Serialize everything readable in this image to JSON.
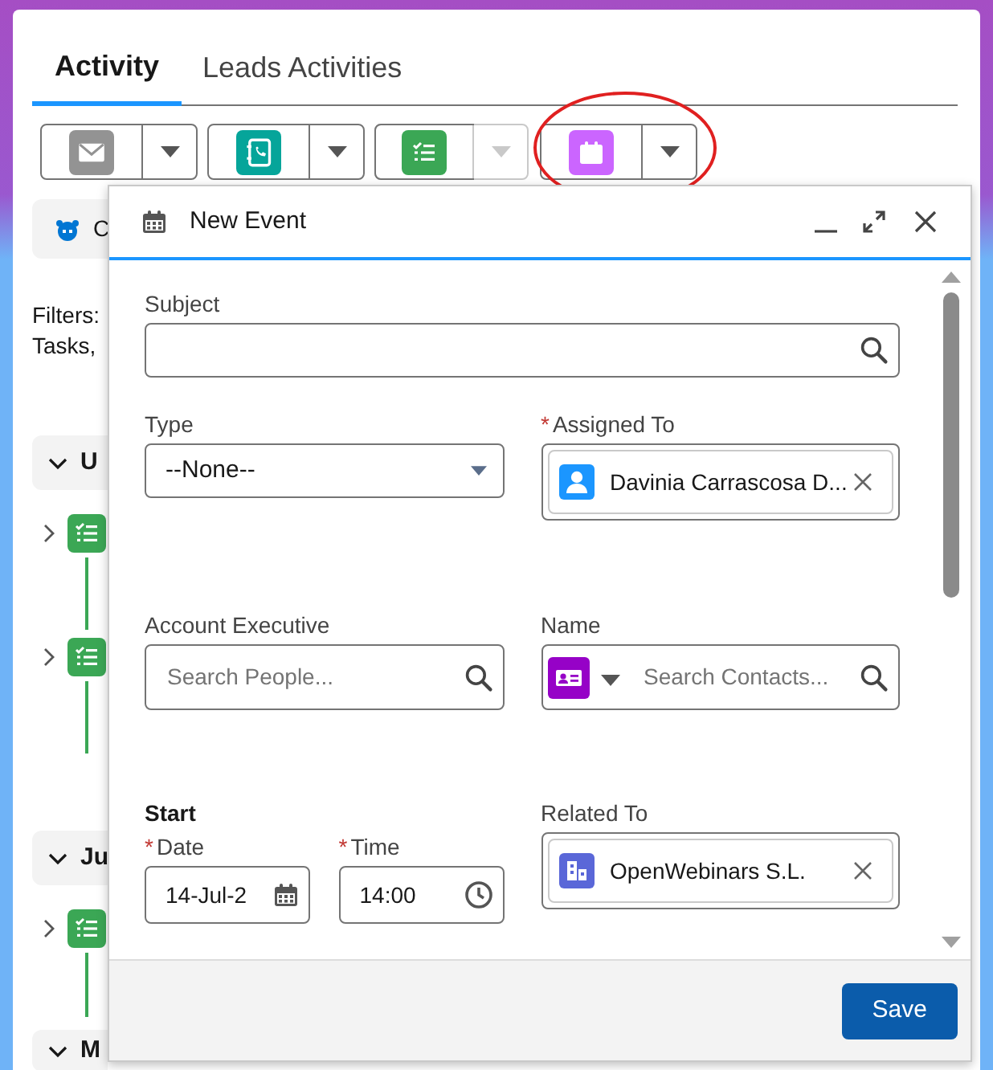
{
  "tabs": [
    {
      "label": "Activity",
      "selected": true
    },
    {
      "label": "Leads Activities",
      "selected": false
    }
  ],
  "action_buttons": [
    {
      "kind": "email",
      "caret_disabled": false,
      "circled": false
    },
    {
      "kind": "call",
      "caret_disabled": false,
      "circled": false
    },
    {
      "kind": "task",
      "caret_disabled": true,
      "circled": false
    },
    {
      "kind": "event",
      "caret_disabled": false,
      "circled": true
    }
  ],
  "feed": {
    "banner_text": "C",
    "filters_lines": [
      "Filters:",
      "Tasks,"
    ],
    "groups": [
      {
        "label": "U",
        "expanded": true,
        "items": [
          {
            "kind": "task",
            "expanded": false
          },
          {
            "kind": "task",
            "expanded": false
          }
        ]
      },
      {
        "label": "Ju",
        "expanded": true,
        "items": [
          {
            "kind": "task",
            "expanded": false
          }
        ]
      },
      {
        "label": "M",
        "expanded": true
      }
    ]
  },
  "modal": {
    "title": "New Event",
    "rows": [
      [
        {
          "kind": "search",
          "label": "Subject"
        }
      ],
      [
        {
          "kind": "select",
          "label": "Type",
          "value": "--None--"
        },
        {
          "kind": "user_pill",
          "label": "Assigned To",
          "required_mark": "*",
          "value": "Davinia Carrascosa D..."
        }
      ],
      [
        {
          "kind": "search",
          "label": "Account Executive",
          "placeholder": "Search People..."
        },
        {
          "kind": "contact_lookup",
          "label": "Name",
          "placeholder": "Search Contacts..."
        }
      ],
      [
        {
          "kind": "datetime",
          "label": "Start",
          "parts": [
            {
              "kind": "date",
              "label": "Date",
              "required_mark": "*",
              "value": "14-Jul-2"
            },
            {
              "kind": "time",
              "label": "Time",
              "required_mark": "*",
              "value": "14:00"
            }
          ]
        },
        {
          "kind": "account_pill",
          "label": "Related To",
          "value": "OpenWebinars S.L."
        }
      ]
    ],
    "save_label": "Save"
  }
}
